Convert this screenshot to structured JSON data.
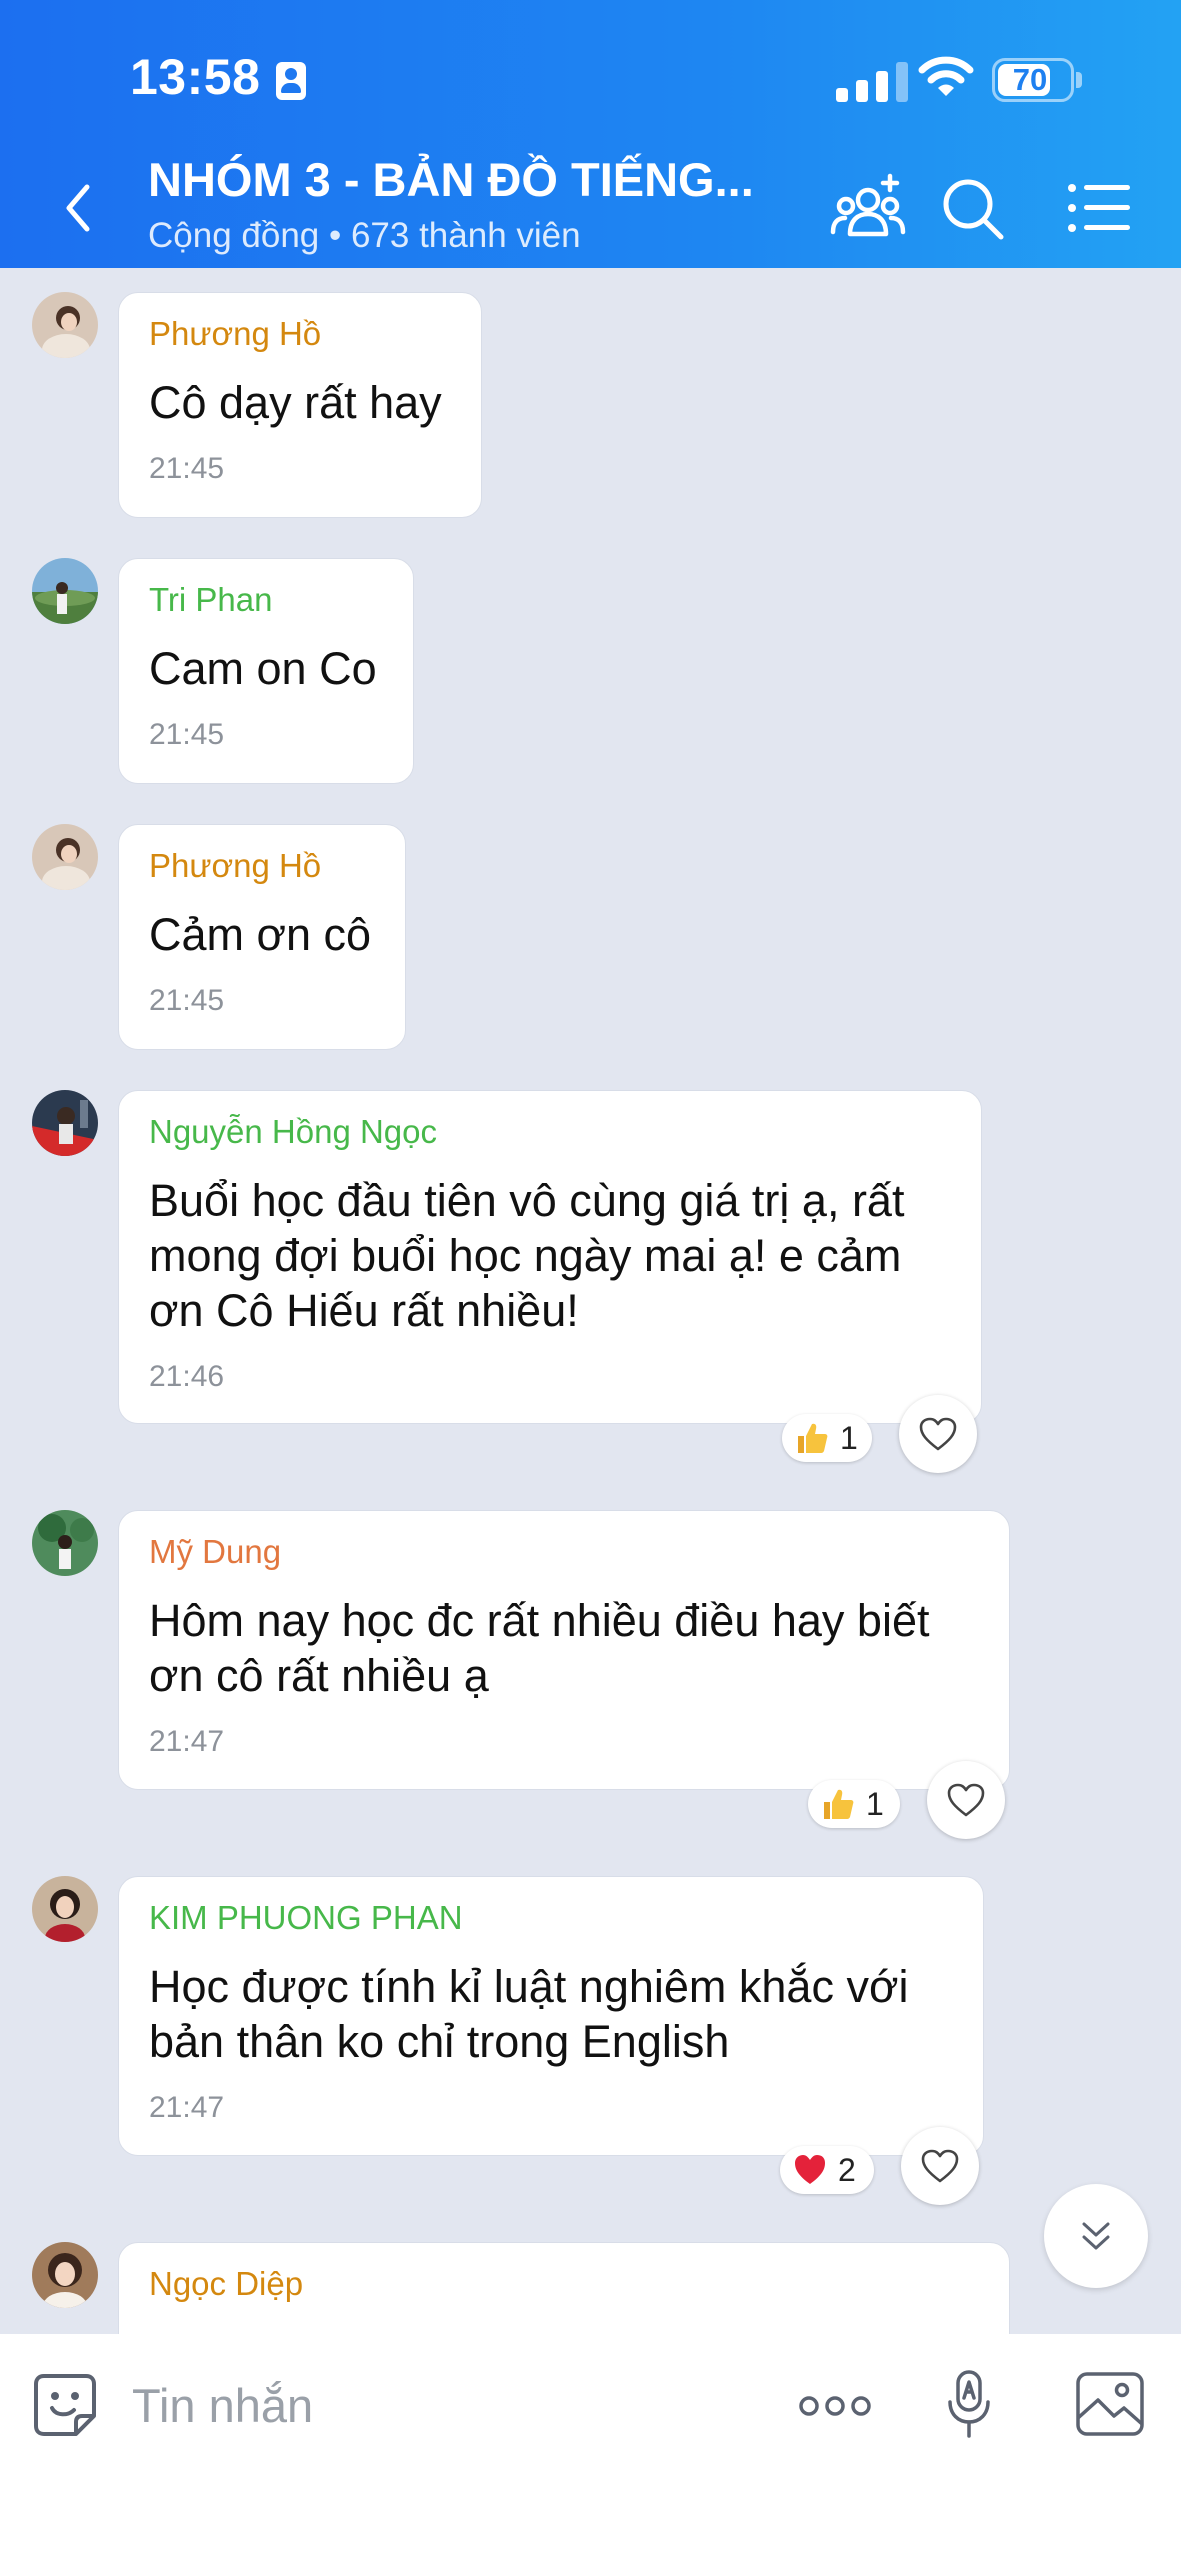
{
  "status_bar": {
    "time": "13:58",
    "battery": "70"
  },
  "header": {
    "title": "NHÓM 3 - BẢN ĐỒ TIẾNG...",
    "subtitle": "Cộng đồng • 673 thành viên",
    "icons": [
      "back-icon",
      "add-member-icon",
      "search-icon",
      "menu-list-icon"
    ]
  },
  "messages": [
    {
      "sender": "Phương Hồ",
      "sender_color": "#d4880f",
      "text": "Cô dạy rất hay",
      "time": "21:45"
    },
    {
      "sender": "Tri Phan",
      "sender_color": "#47b84a",
      "text": "Cam on Co",
      "time": "21:45"
    },
    {
      "sender": "Phương Hồ",
      "sender_color": "#d4880f",
      "text": "Cảm ơn cô",
      "time": "21:45"
    },
    {
      "sender": "Nguyễn Hồng Ngọc",
      "sender_color": "#47b84a",
      "text": "Buổi học đầu tiên vô cùng giá trị ạ, rất mong đợi buổi học ngày mai ạ! e cảm ơn Cô Hiếu rất nhiều!",
      "time": "21:46",
      "reaction": {
        "emoji": "thumbs-up",
        "count": "1"
      }
    },
    {
      "sender": "Mỹ Dung",
      "sender_color": "#e2773f",
      "text": "Hôm nay học đc rất nhiều điều hay biết ơn cô rất nhiều ạ",
      "time": "21:47",
      "reaction": {
        "emoji": "thumbs-up",
        "count": "1"
      }
    },
    {
      "sender": "KIM PHUONG PHAN",
      "sender_color": "#47b84a",
      "text": "Học được tính kỉ luật  nghiêm khắc với bản thân ko chỉ trong English",
      "time": "21:47",
      "reaction": {
        "emoji": "heart",
        "count": "2"
      }
    },
    {
      "sender": "Ngọc Diệp",
      "sender_color": "#d4880f",
      "text": "",
      "time": ""
    }
  ],
  "input": {
    "placeholder": "Tin nhắn"
  },
  "colors": {
    "header_start": "#1c6ff0",
    "header_end": "#23a2f3",
    "chat_bg": "#e2e6f0"
  }
}
